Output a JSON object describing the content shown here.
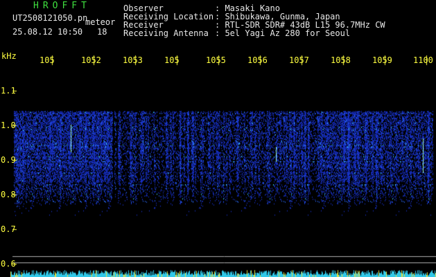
{
  "header": {
    "logo": "HROFFT",
    "filename": "UT2508121050.pn",
    "meteor_label": "meteor",
    "datetime": "25.08.12 10:50",
    "meteor_count": "18"
  },
  "station": {
    "rows": [
      {
        "label": "Observer",
        "value": ": Masaki Kano"
      },
      {
        "label": "Receiving Location",
        "value": ": Shibukawa, Gunma, Japan"
      },
      {
        "label": "Receiver",
        "value": ": RTL-SDR SDR# 43dB L15 96.7MHz CW"
      },
      {
        "label": "Receiving Antenna",
        "value": ": 5el Yagi Az 280 for Seoul"
      }
    ]
  },
  "axes": {
    "y_unit": "kHz",
    "x_ticks": [
      "105",
      "1052",
      "1053",
      "105",
      "1055",
      "1056",
      "1057",
      "1058",
      "1059",
      "1100"
    ],
    "y_ticks": [
      "1.1",
      "1.0",
      "0.9",
      "0.8",
      "0.7",
      "0.6"
    ]
  },
  "colors": {
    "background": "#000000",
    "text_green": "#3fe03f",
    "text_white": "#e8e8e8",
    "axis_yellow": "#ffff40",
    "signal_blue": "#1c3cff",
    "signal_cyan": "#40e0ff",
    "guide_line": "#b0b0b0"
  }
}
